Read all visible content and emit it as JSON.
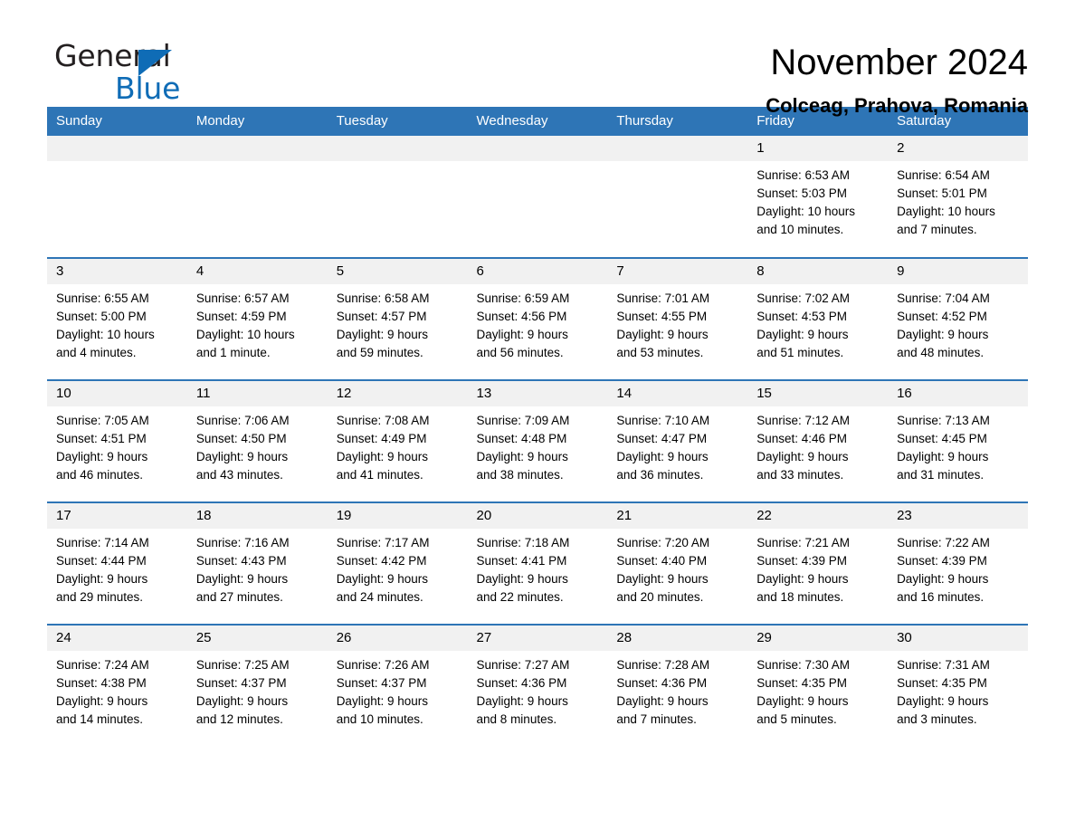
{
  "brand": {
    "name_part1": "General",
    "name_part2": "Blue",
    "triangle_icon": "triangle-icon",
    "accent_color": "#0f6cb6"
  },
  "header": {
    "month_title": "November 2024",
    "location": "Colceag, Prahova, Romania"
  },
  "theme": {
    "header_blue": "#2e75b6",
    "daynum_band": "#f1f1f1",
    "text": "#000000"
  },
  "weekday_headers": [
    "Sunday",
    "Monday",
    "Tuesday",
    "Wednesday",
    "Thursday",
    "Friday",
    "Saturday"
  ],
  "weeks": [
    [
      {
        "day": "",
        "sunrise": "",
        "sunset": "",
        "daylight_line1": "",
        "daylight_line2": ""
      },
      {
        "day": "",
        "sunrise": "",
        "sunset": "",
        "daylight_line1": "",
        "daylight_line2": ""
      },
      {
        "day": "",
        "sunrise": "",
        "sunset": "",
        "daylight_line1": "",
        "daylight_line2": ""
      },
      {
        "day": "",
        "sunrise": "",
        "sunset": "",
        "daylight_line1": "",
        "daylight_line2": ""
      },
      {
        "day": "",
        "sunrise": "",
        "sunset": "",
        "daylight_line1": "",
        "daylight_line2": ""
      },
      {
        "day": "1",
        "sunrise": "Sunrise: 6:53 AM",
        "sunset": "Sunset: 5:03 PM",
        "daylight_line1": "Daylight: 10 hours",
        "daylight_line2": "and 10 minutes."
      },
      {
        "day": "2",
        "sunrise": "Sunrise: 6:54 AM",
        "sunset": "Sunset: 5:01 PM",
        "daylight_line1": "Daylight: 10 hours",
        "daylight_line2": "and 7 minutes."
      }
    ],
    [
      {
        "day": "3",
        "sunrise": "Sunrise: 6:55 AM",
        "sunset": "Sunset: 5:00 PM",
        "daylight_line1": "Daylight: 10 hours",
        "daylight_line2": "and 4 minutes."
      },
      {
        "day": "4",
        "sunrise": "Sunrise: 6:57 AM",
        "sunset": "Sunset: 4:59 PM",
        "daylight_line1": "Daylight: 10 hours",
        "daylight_line2": "and 1 minute."
      },
      {
        "day": "5",
        "sunrise": "Sunrise: 6:58 AM",
        "sunset": "Sunset: 4:57 PM",
        "daylight_line1": "Daylight: 9 hours",
        "daylight_line2": "and 59 minutes."
      },
      {
        "day": "6",
        "sunrise": "Sunrise: 6:59 AM",
        "sunset": "Sunset: 4:56 PM",
        "daylight_line1": "Daylight: 9 hours",
        "daylight_line2": "and 56 minutes."
      },
      {
        "day": "7",
        "sunrise": "Sunrise: 7:01 AM",
        "sunset": "Sunset: 4:55 PM",
        "daylight_line1": "Daylight: 9 hours",
        "daylight_line2": "and 53 minutes."
      },
      {
        "day": "8",
        "sunrise": "Sunrise: 7:02 AM",
        "sunset": "Sunset: 4:53 PM",
        "daylight_line1": "Daylight: 9 hours",
        "daylight_line2": "and 51 minutes."
      },
      {
        "day": "9",
        "sunrise": "Sunrise: 7:04 AM",
        "sunset": "Sunset: 4:52 PM",
        "daylight_line1": "Daylight: 9 hours",
        "daylight_line2": "and 48 minutes."
      }
    ],
    [
      {
        "day": "10",
        "sunrise": "Sunrise: 7:05 AM",
        "sunset": "Sunset: 4:51 PM",
        "daylight_line1": "Daylight: 9 hours",
        "daylight_line2": "and 46 minutes."
      },
      {
        "day": "11",
        "sunrise": "Sunrise: 7:06 AM",
        "sunset": "Sunset: 4:50 PM",
        "daylight_line1": "Daylight: 9 hours",
        "daylight_line2": "and 43 minutes."
      },
      {
        "day": "12",
        "sunrise": "Sunrise: 7:08 AM",
        "sunset": "Sunset: 4:49 PM",
        "daylight_line1": "Daylight: 9 hours",
        "daylight_line2": "and 41 minutes."
      },
      {
        "day": "13",
        "sunrise": "Sunrise: 7:09 AM",
        "sunset": "Sunset: 4:48 PM",
        "daylight_line1": "Daylight: 9 hours",
        "daylight_line2": "and 38 minutes."
      },
      {
        "day": "14",
        "sunrise": "Sunrise: 7:10 AM",
        "sunset": "Sunset: 4:47 PM",
        "daylight_line1": "Daylight: 9 hours",
        "daylight_line2": "and 36 minutes."
      },
      {
        "day": "15",
        "sunrise": "Sunrise: 7:12 AM",
        "sunset": "Sunset: 4:46 PM",
        "daylight_line1": "Daylight: 9 hours",
        "daylight_line2": "and 33 minutes."
      },
      {
        "day": "16",
        "sunrise": "Sunrise: 7:13 AM",
        "sunset": "Sunset: 4:45 PM",
        "daylight_line1": "Daylight: 9 hours",
        "daylight_line2": "and 31 minutes."
      }
    ],
    [
      {
        "day": "17",
        "sunrise": "Sunrise: 7:14 AM",
        "sunset": "Sunset: 4:44 PM",
        "daylight_line1": "Daylight: 9 hours",
        "daylight_line2": "and 29 minutes."
      },
      {
        "day": "18",
        "sunrise": "Sunrise: 7:16 AM",
        "sunset": "Sunset: 4:43 PM",
        "daylight_line1": "Daylight: 9 hours",
        "daylight_line2": "and 27 minutes."
      },
      {
        "day": "19",
        "sunrise": "Sunrise: 7:17 AM",
        "sunset": "Sunset: 4:42 PM",
        "daylight_line1": "Daylight: 9 hours",
        "daylight_line2": "and 24 minutes."
      },
      {
        "day": "20",
        "sunrise": "Sunrise: 7:18 AM",
        "sunset": "Sunset: 4:41 PM",
        "daylight_line1": "Daylight: 9 hours",
        "daylight_line2": "and 22 minutes."
      },
      {
        "day": "21",
        "sunrise": "Sunrise: 7:20 AM",
        "sunset": "Sunset: 4:40 PM",
        "daylight_line1": "Daylight: 9 hours",
        "daylight_line2": "and 20 minutes."
      },
      {
        "day": "22",
        "sunrise": "Sunrise: 7:21 AM",
        "sunset": "Sunset: 4:39 PM",
        "daylight_line1": "Daylight: 9 hours",
        "daylight_line2": "and 18 minutes."
      },
      {
        "day": "23",
        "sunrise": "Sunrise: 7:22 AM",
        "sunset": "Sunset: 4:39 PM",
        "daylight_line1": "Daylight: 9 hours",
        "daylight_line2": "and 16 minutes."
      }
    ],
    [
      {
        "day": "24",
        "sunrise": "Sunrise: 7:24 AM",
        "sunset": "Sunset: 4:38 PM",
        "daylight_line1": "Daylight: 9 hours",
        "daylight_line2": "and 14 minutes."
      },
      {
        "day": "25",
        "sunrise": "Sunrise: 7:25 AM",
        "sunset": "Sunset: 4:37 PM",
        "daylight_line1": "Daylight: 9 hours",
        "daylight_line2": "and 12 minutes."
      },
      {
        "day": "26",
        "sunrise": "Sunrise: 7:26 AM",
        "sunset": "Sunset: 4:37 PM",
        "daylight_line1": "Daylight: 9 hours",
        "daylight_line2": "and 10 minutes."
      },
      {
        "day": "27",
        "sunrise": "Sunrise: 7:27 AM",
        "sunset": "Sunset: 4:36 PM",
        "daylight_line1": "Daylight: 9 hours",
        "daylight_line2": "and 8 minutes."
      },
      {
        "day": "28",
        "sunrise": "Sunrise: 7:28 AM",
        "sunset": "Sunset: 4:36 PM",
        "daylight_line1": "Daylight: 9 hours",
        "daylight_line2": "and 7 minutes."
      },
      {
        "day": "29",
        "sunrise": "Sunrise: 7:30 AM",
        "sunset": "Sunset: 4:35 PM",
        "daylight_line1": "Daylight: 9 hours",
        "daylight_line2": "and 5 minutes."
      },
      {
        "day": "30",
        "sunrise": "Sunrise: 7:31 AM",
        "sunset": "Sunset: 4:35 PM",
        "daylight_line1": "Daylight: 9 hours",
        "daylight_line2": "and 3 minutes."
      }
    ]
  ]
}
